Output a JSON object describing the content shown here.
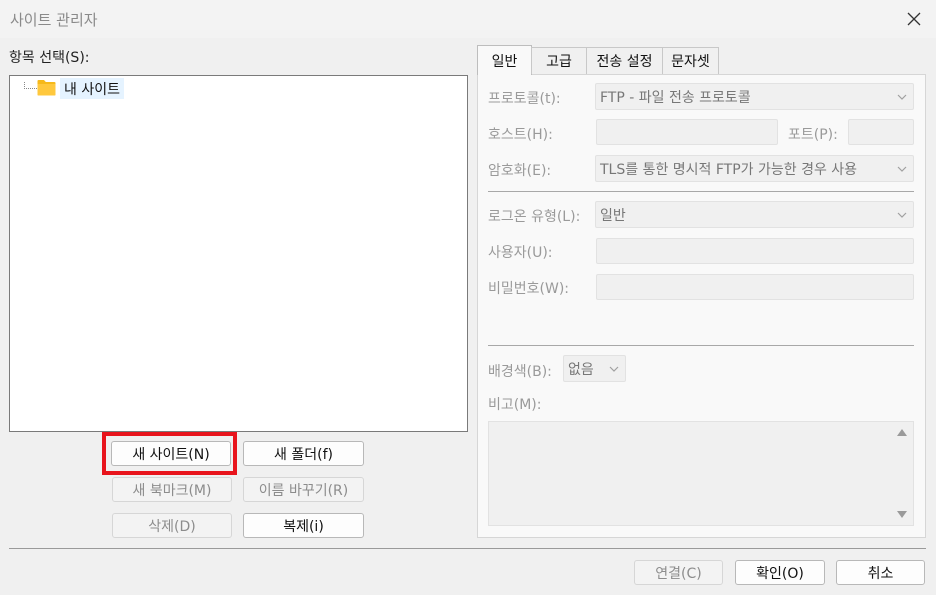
{
  "window": {
    "title": "사이트 관리자"
  },
  "left_panel": {
    "select_label": "항목 선택(S):",
    "tree_items": [
      {
        "label": "내 사이트",
        "icon": "folder-icon"
      }
    ]
  },
  "buttons": {
    "new_site": "새 사이트(N)",
    "new_folder": "새 폴더(f)",
    "new_bookmark": "새 북마크(M)",
    "rename": "이름 바꾸기(R)",
    "delete": "삭제(D)",
    "duplicate": "복제(i)",
    "connect": "연결(C)",
    "ok": "확인(O)",
    "cancel": "취소"
  },
  "tabs": [
    {
      "label": "일반",
      "active": true
    },
    {
      "label": "고급",
      "active": false
    },
    {
      "label": "전송 설정",
      "active": false
    },
    {
      "label": "문자셋",
      "active": false
    }
  ],
  "general": {
    "protocol_label": "프로토콜(t):",
    "protocol_value": "FTP - 파일 전송 프로토콜",
    "host_label": "호스트(H):",
    "host_value": "",
    "port_label": "포트(P):",
    "port_value": "",
    "encryption_label": "암호화(E):",
    "encryption_value": "TLS를 통한 명시적 FTP가 가능한 경우 사용",
    "logon_type_label": "로그온 유형(L):",
    "logon_type_value": "일반",
    "user_label": "사용자(U):",
    "user_value": "",
    "password_label": "비밀번호(W):",
    "password_value": "",
    "background_label": "배경색(B):",
    "background_value": "없음",
    "comments_label": "비고(M):",
    "comments_value": ""
  },
  "colors": {
    "highlight": "#e8141c",
    "tree_selection": "#e5f3ff",
    "folder": "#f6b91a"
  }
}
